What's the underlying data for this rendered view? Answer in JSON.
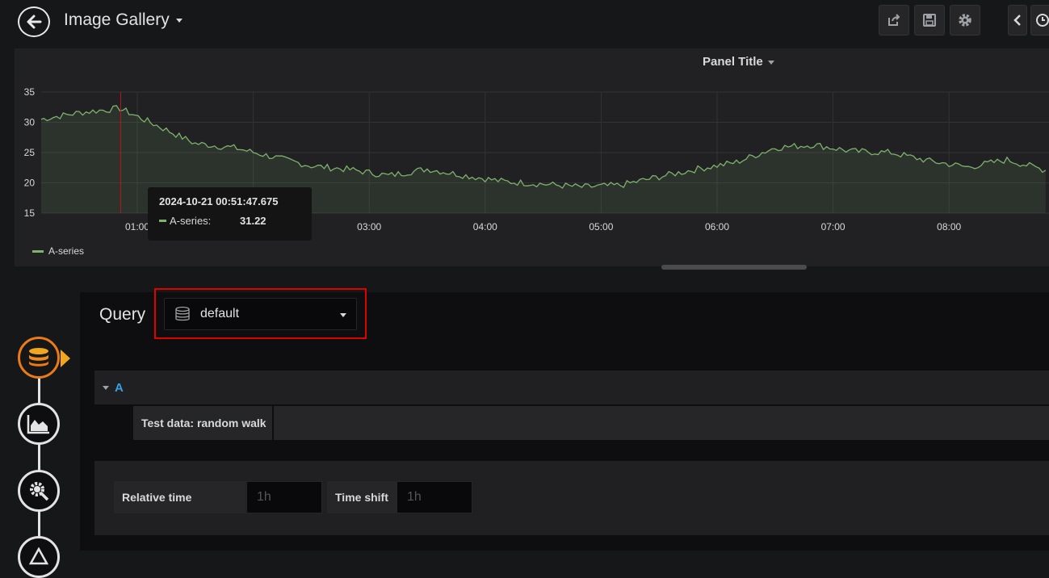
{
  "header": {
    "title": "Image Gallery",
    "buttons": [
      "share-icon",
      "save-icon",
      "settings-icon",
      "chevron-left-icon",
      "clock-icon"
    ]
  },
  "panel": {
    "title": "Panel Title",
    "legend": "A-series",
    "tooltip": {
      "time": "2024-10-21 00:51:47.675",
      "series": "A-series:",
      "value": "31.22"
    }
  },
  "chart_data": {
    "type": "area",
    "x": [
      "00:10",
      "00:30",
      "00:51",
      "01:10",
      "01:30",
      "01:50",
      "02:10",
      "02:30",
      "02:50",
      "03:10",
      "03:30",
      "03:50",
      "04:10",
      "04:30",
      "04:50",
      "05:10",
      "05:30",
      "05:50",
      "06:10",
      "06:30",
      "06:50",
      "07:10",
      "07:30",
      "07:50",
      "08:10",
      "08:30",
      "08:50"
    ],
    "series": [
      {
        "name": "A-series",
        "color": "#7eb26d",
        "values": [
          30.5,
          31.6,
          32.3,
          29.5,
          26.5,
          25.8,
          24.3,
          22.8,
          22.2,
          21.2,
          22.3,
          21.2,
          20.2,
          19.8,
          19.3,
          19.6,
          21.0,
          22.3,
          23.4,
          25.8,
          26.3,
          25.2,
          25.0,
          23.6,
          22.6,
          23.8,
          22.1
        ]
      }
    ],
    "y_ticks": [
      "35",
      "30",
      "25",
      "20",
      "15"
    ],
    "x_ticks": [
      "01:00",
      "02:00",
      "03:00",
      "04:00",
      "05:00",
      "06:00",
      "07:00",
      "08:00"
    ],
    "ylim": [
      15,
      35
    ],
    "grid": true,
    "legend_position": "bottom-left"
  },
  "editor": {
    "query_label": "Query",
    "datasource": "default",
    "query_row": "A",
    "scenario": "Test data: random walk",
    "options": {
      "relative_time_label": "Relative time",
      "relative_time_placeholder": "1h",
      "time_shift_label": "Time shift",
      "time_shift_placeholder": "1h"
    }
  },
  "sidenav": [
    "database-icon",
    "chart-area-icon",
    "settings-cog-icon",
    "alert-icon"
  ],
  "colors": {
    "accent": "#eb7b18",
    "series": "#7eb26d",
    "highlight": "#e00000",
    "query_letter": "#33a2e5"
  }
}
